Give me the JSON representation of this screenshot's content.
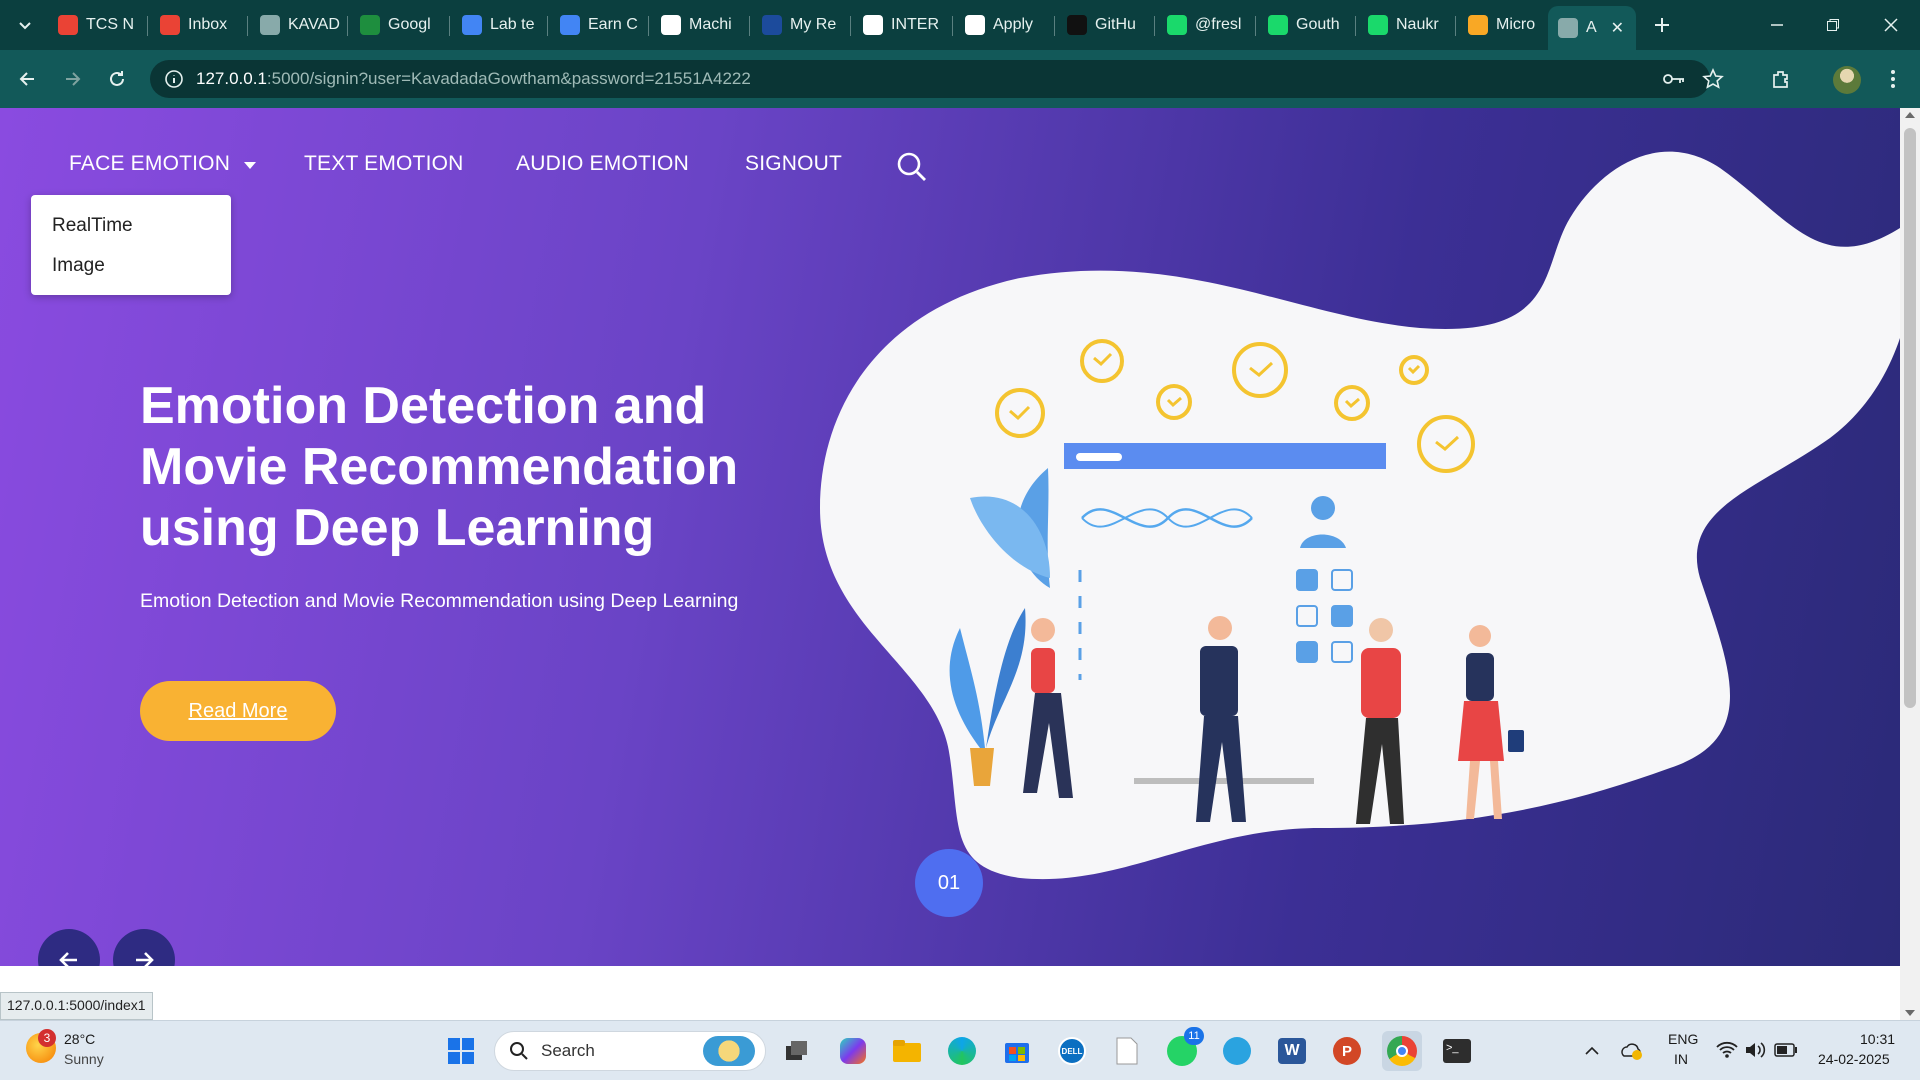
{
  "browser": {
    "tabs": [
      {
        "title": "TCS N",
        "fav": "gmail-icon",
        "color": "#ea4335"
      },
      {
        "title": "Inbox",
        "fav": "gmail-icon",
        "color": "#ea4335"
      },
      {
        "title": "KAVAD",
        "fav": "globe-icon",
        "color": "#8aa"
      },
      {
        "title": "Googl",
        "fav": "sheets-icon",
        "color": "#1e8e3e"
      },
      {
        "title": "Lab te",
        "fav": "cloud-icon",
        "color": "#4285f4"
      },
      {
        "title": "Earn C",
        "fav": "cloud-icon",
        "color": "#4285f4"
      },
      {
        "title": "Machi",
        "fav": "google-icon",
        "color": "#ffffff"
      },
      {
        "title": "My Re",
        "fav": "unstop-icon",
        "color": "#1c4b9c"
      },
      {
        "title": "INTER",
        "fav": "intern-icon",
        "color": "#ffffff"
      },
      {
        "title": "Apply",
        "fav": "tata-icon",
        "color": "#ffffff"
      },
      {
        "title": "GitHu",
        "fav": "github-icon",
        "color": "#111111"
      },
      {
        "title": "@fresl",
        "fav": "asterisk-icon",
        "color": "#1ad96b"
      },
      {
        "title": "Gouth",
        "fav": "asterisk-icon",
        "color": "#1ad96b"
      },
      {
        "title": "Naukr",
        "fav": "asterisk-icon",
        "color": "#1ad96b"
      },
      {
        "title": "Micro",
        "fav": "loading-icon",
        "color": "#f9a825"
      },
      {
        "title": "A",
        "fav": "globe-icon",
        "color": "#8aa"
      }
    ],
    "url_host": "127.0.0.1",
    "url_rest": ":5000/signin?user=KavadadaGowtham&password=21551A4222",
    "status_url": "127.0.0.1:5000/index1"
  },
  "nav": {
    "face": "FACE EMOTION",
    "text": "TEXT EMOTION",
    "audio": "AUDIO EMOTION",
    "signout": "SIGNOUT"
  },
  "dropdown": {
    "item1": "RealTime",
    "item2": "Image"
  },
  "hero": {
    "headline": "Emotion Detection and Movie Recommendation using Deep Learning",
    "subline": "Emotion Detection and Movie Recommendation using Deep Learning",
    "button": "Read More",
    "slide_number": "01"
  },
  "taskbar": {
    "weather_temp": "28°C",
    "weather_desc": "Sunny",
    "weather_badge": "3",
    "search_placeholder": "Search",
    "lang_line1": "ENG",
    "lang_line2": "IN",
    "time": "10:31",
    "date": "24-02-2025",
    "whatsapp_badge": "11"
  },
  "colors": {
    "accent": "#f9b233",
    "slide_circle": "#4f6ef0",
    "nav_button": "#2e2b82"
  }
}
